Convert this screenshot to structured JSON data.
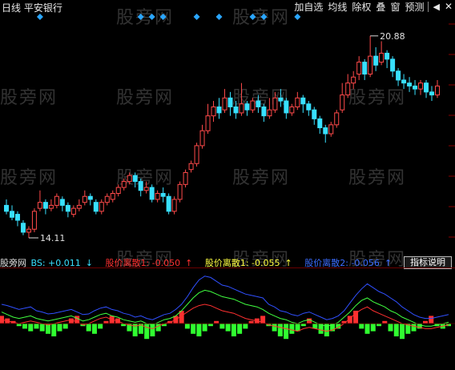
{
  "header": {
    "period": "日线",
    "stock_name": "平安银行",
    "toolbar": [
      "加自选",
      "均线",
      "除权",
      "叠",
      "窗",
      "预测"
    ],
    "back_icon": "◀",
    "close_icon": "✕"
  },
  "watermark": "股旁网",
  "price_chart": {
    "high_label": "20.88",
    "low_label": "14.11",
    "colors": {
      "up": "#ff4a4a",
      "down": "#38e0ff",
      "marker": "#2aa6ff"
    },
    "price_range": [
      13.6,
      21.6
    ],
    "candles": [
      [
        15.2,
        15.0,
        15.4,
        14.9
      ],
      [
        15.0,
        14.8,
        15.2,
        14.7
      ],
      [
        14.9,
        14.7,
        15.0,
        14.5
      ],
      [
        14.6,
        14.3,
        14.7,
        14.2
      ],
      [
        14.3,
        14.4,
        14.5,
        14.11
      ],
      [
        14.4,
        15.0,
        15.1,
        14.3
      ],
      [
        15.1,
        15.3,
        15.7,
        15.0
      ],
      [
        15.3,
        15.1,
        15.4,
        14.9
      ],
      [
        15.1,
        15.2,
        15.4,
        15.0
      ],
      [
        15.2,
        15.5,
        15.6,
        15.1
      ],
      [
        15.4,
        15.2,
        15.5,
        15.0
      ],
      [
        15.2,
        15.0,
        15.3,
        14.8
      ],
      [
        14.9,
        15.1,
        15.2,
        14.8
      ],
      [
        15.1,
        15.2,
        15.4,
        15.0
      ],
      [
        15.3,
        15.5,
        15.7,
        15.2
      ],
      [
        15.5,
        15.4,
        15.6,
        15.2
      ],
      [
        15.3,
        15.0,
        15.4,
        14.9
      ],
      [
        15.0,
        15.3,
        15.4,
        14.9
      ],
      [
        15.3,
        15.5,
        15.6,
        15.2
      ],
      [
        15.4,
        15.6,
        15.7,
        15.3
      ],
      [
        15.6,
        15.8,
        15.9,
        15.5
      ],
      [
        15.8,
        16.0,
        16.1,
        15.7
      ],
      [
        16.0,
        16.2,
        16.3,
        15.9
      ],
      [
        16.2,
        16.0,
        16.3,
        15.8
      ],
      [
        16.0,
        15.7,
        16.1,
        15.5
      ],
      [
        15.7,
        15.8,
        16.0,
        15.6
      ],
      [
        15.8,
        15.4,
        15.9,
        15.3
      ],
      [
        15.4,
        15.6,
        15.7,
        15.3
      ],
      [
        15.6,
        15.5,
        15.8,
        15.3
      ],
      [
        15.5,
        15.0,
        15.6,
        14.9
      ],
      [
        15.0,
        15.4,
        15.5,
        14.9
      ],
      [
        15.4,
        15.9,
        16.0,
        15.3
      ],
      [
        15.9,
        16.3,
        16.4,
        15.8
      ],
      [
        16.4,
        16.6,
        16.7,
        16.3
      ],
      [
        16.6,
        17.2,
        17.3,
        16.5
      ],
      [
        17.2,
        17.7,
        17.9,
        17.1
      ],
      [
        17.7,
        18.2,
        18.6,
        17.6
      ],
      [
        18.2,
        18.5,
        18.7,
        18.0
      ],
      [
        18.5,
        18.3,
        18.8,
        18.1
      ],
      [
        18.4,
        18.8,
        19.1,
        18.3
      ],
      [
        18.8,
        18.5,
        19.0,
        18.2
      ],
      [
        18.5,
        18.3,
        18.7,
        18.1
      ],
      [
        18.3,
        18.6,
        19.3,
        18.2
      ],
      [
        18.6,
        18.4,
        18.7,
        18.2
      ],
      [
        18.4,
        18.7,
        18.8,
        18.3
      ],
      [
        18.7,
        18.5,
        18.9,
        18.3
      ],
      [
        18.5,
        18.2,
        18.6,
        18.0
      ],
      [
        18.2,
        18.4,
        18.8,
        18.1
      ],
      [
        18.4,
        18.8,
        19.0,
        18.3
      ],
      [
        18.8,
        18.7,
        19.1,
        18.5
      ],
      [
        18.7,
        18.3,
        18.8,
        18.1
      ],
      [
        18.3,
        18.5,
        18.6,
        18.2
      ],
      [
        18.5,
        18.8,
        19.0,
        18.4
      ],
      [
        18.8,
        18.6,
        18.9,
        18.3
      ],
      [
        18.6,
        18.4,
        18.7,
        18.2
      ],
      [
        18.4,
        18.1,
        18.5,
        17.9
      ],
      [
        18.1,
        17.8,
        18.2,
        17.6
      ],
      [
        17.8,
        17.6,
        17.9,
        17.3
      ],
      [
        17.6,
        17.9,
        18.0,
        17.5
      ],
      [
        17.9,
        18.3,
        18.4,
        17.8
      ],
      [
        18.4,
        18.9,
        19.3,
        18.3
      ],
      [
        18.9,
        19.3,
        19.6,
        18.8
      ],
      [
        19.3,
        19.5,
        19.7,
        19.1
      ],
      [
        19.6,
        20.0,
        20.2,
        19.4
      ],
      [
        20.0,
        19.6,
        20.1,
        19.4
      ],
      [
        19.6,
        20.2,
        20.88,
        19.5
      ],
      [
        20.2,
        19.9,
        20.5,
        19.7
      ],
      [
        20.0,
        20.3,
        20.7,
        19.9
      ],
      [
        20.3,
        20.1,
        20.4,
        19.8
      ],
      [
        20.1,
        19.7,
        20.2,
        19.5
      ],
      [
        19.7,
        19.4,
        19.8,
        19.2
      ],
      [
        19.4,
        19.3,
        19.6,
        19.1
      ],
      [
        19.3,
        19.2,
        19.5,
        19.0
      ],
      [
        19.2,
        19.1,
        19.4,
        18.9
      ],
      [
        19.1,
        19.3,
        19.4,
        18.9
      ],
      [
        19.3,
        19.0,
        19.4,
        18.8
      ],
      [
        19.0,
        18.9,
        19.2,
        18.7
      ],
      [
        18.9,
        19.2,
        19.4,
        18.8
      ]
    ],
    "signal_markers": [
      6,
      24,
      26,
      28,
      34,
      38,
      44,
      46,
      52
    ]
  },
  "indicator": {
    "name": "股旁网",
    "lines": [
      {
        "label": "BS: +0.011",
        "arrow": "↓",
        "color": "#38e0ff"
      },
      {
        "label": "股价离散1: -0.050",
        "arrow": "↑",
        "color": "#ff3030"
      },
      {
        "label": "股价离散1: -0.055",
        "arrow": "↑",
        "color": "#ffff40"
      },
      {
        "label": "股价离散2: -0.056",
        "arrow": "↑",
        "color": "#3a6cff"
      }
    ],
    "button": "指标说明",
    "series_colors": {
      "blue": "#3050ff",
      "green": "#40ff40",
      "red": "#ff3030",
      "hist_pos": "#ff3030",
      "hist_neg": "#30ff30"
    },
    "blue": [
      30,
      28,
      25,
      22,
      24,
      26,
      20,
      18,
      15,
      16,
      18,
      20,
      22,
      18,
      14,
      15,
      20,
      24,
      26,
      22,
      20,
      16,
      14,
      10,
      12,
      8,
      6,
      10,
      14,
      16,
      22,
      30,
      42,
      56,
      68,
      74,
      72,
      66,
      60,
      58,
      54,
      50,
      46,
      44,
      42,
      40,
      30,
      26,
      20,
      18,
      14,
      12,
      16,
      18,
      14,
      10,
      6,
      8,
      12,
      20,
      32,
      44,
      54,
      62,
      56,
      50,
      46,
      40,
      34,
      26,
      20,
      14,
      10,
      8,
      8,
      10,
      12,
      14
    ],
    "green": [
      18,
      14,
      10,
      8,
      10,
      12,
      8,
      6,
      4,
      6,
      8,
      10,
      12,
      8,
      4,
      6,
      10,
      14,
      16,
      12,
      10,
      6,
      4,
      2,
      4,
      0,
      -2,
      2,
      6,
      8,
      12,
      20,
      30,
      40,
      48,
      52,
      50,
      46,
      42,
      40,
      38,
      34,
      30,
      28,
      26,
      22,
      16,
      12,
      8,
      6,
      2,
      0,
      4,
      6,
      2,
      -2,
      -4,
      -2,
      2,
      10,
      18,
      28,
      36,
      40,
      34,
      30,
      26,
      20,
      16,
      10,
      6,
      2,
      -2,
      -4,
      -4,
      -2,
      0,
      2
    ],
    "red": [
      6,
      4,
      2,
      0,
      2,
      4,
      2,
      0,
      -2,
      0,
      2,
      4,
      6,
      2,
      -2,
      0,
      4,
      8,
      10,
      6,
      4,
      0,
      -2,
      -4,
      -2,
      -6,
      -8,
      -4,
      0,
      2,
      6,
      12,
      18,
      24,
      28,
      30,
      28,
      24,
      20,
      18,
      16,
      12,
      8,
      6,
      4,
      2,
      -2,
      -4,
      -6,
      -8,
      -10,
      -12,
      -8,
      -6,
      -8,
      -10,
      -12,
      -10,
      -6,
      0,
      8,
      16,
      22,
      26,
      20,
      16,
      12,
      8,
      4,
      0,
      -2,
      -4,
      -6,
      -8,
      -8,
      -6,
      -4,
      -2
    ],
    "hist": [
      6,
      4,
      2,
      -2,
      -4,
      -6,
      -4,
      -6,
      -8,
      -10,
      -6,
      -4,
      4,
      6,
      -2,
      -6,
      -8,
      -4,
      2,
      6,
      4,
      -2,
      -6,
      -10,
      -8,
      -12,
      -10,
      -6,
      -2,
      2,
      6,
      10,
      -4,
      -8,
      -10,
      -6,
      -2,
      2,
      -4,
      -6,
      -10,
      -8,
      -4,
      2,
      4,
      6,
      -2,
      -6,
      -10,
      -12,
      -8,
      -6,
      -2,
      4,
      -4,
      -8,
      -10,
      -6,
      -4,
      2,
      6,
      10,
      -4,
      -8,
      -6,
      -2,
      2,
      -6,
      -10,
      -12,
      -8,
      -6,
      -4,
      2,
      6,
      -2,
      -4,
      -2
    ]
  }
}
